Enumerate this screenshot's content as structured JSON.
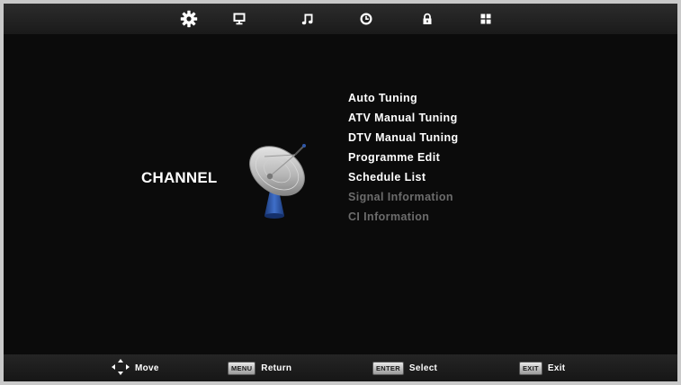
{
  "topbar": {
    "icons": [
      "gear-icon",
      "monitor-icon",
      "music-note-icon",
      "clock-icon",
      "lock-icon",
      "grid-icon"
    ],
    "selected": "gear-icon"
  },
  "page": {
    "title": "CHANNEL"
  },
  "menu": {
    "items": [
      {
        "label": "Auto Tuning",
        "enabled": true
      },
      {
        "label": "ATV Manual Tuning",
        "enabled": true
      },
      {
        "label": "DTV Manual Tuning",
        "enabled": true
      },
      {
        "label": "Programme Edit",
        "enabled": true
      },
      {
        "label": "Schedule List",
        "enabled": true
      },
      {
        "label": "Signal Information",
        "enabled": false
      },
      {
        "label": "CI Information",
        "enabled": false
      }
    ]
  },
  "footer": {
    "move": {
      "label": "Move",
      "icon": "dpad-arrows-icon"
    },
    "return": {
      "key": "MENU",
      "label": "Return"
    },
    "select": {
      "key": "ENTER",
      "label": "Select"
    },
    "exit": {
      "key": "EXIT",
      "label": "Exit"
    }
  },
  "colors": {
    "background": "#0b0b0b",
    "text": "#ffffff",
    "disabled_text": "#6c6c6c",
    "dish_base": "#2f57a8"
  }
}
